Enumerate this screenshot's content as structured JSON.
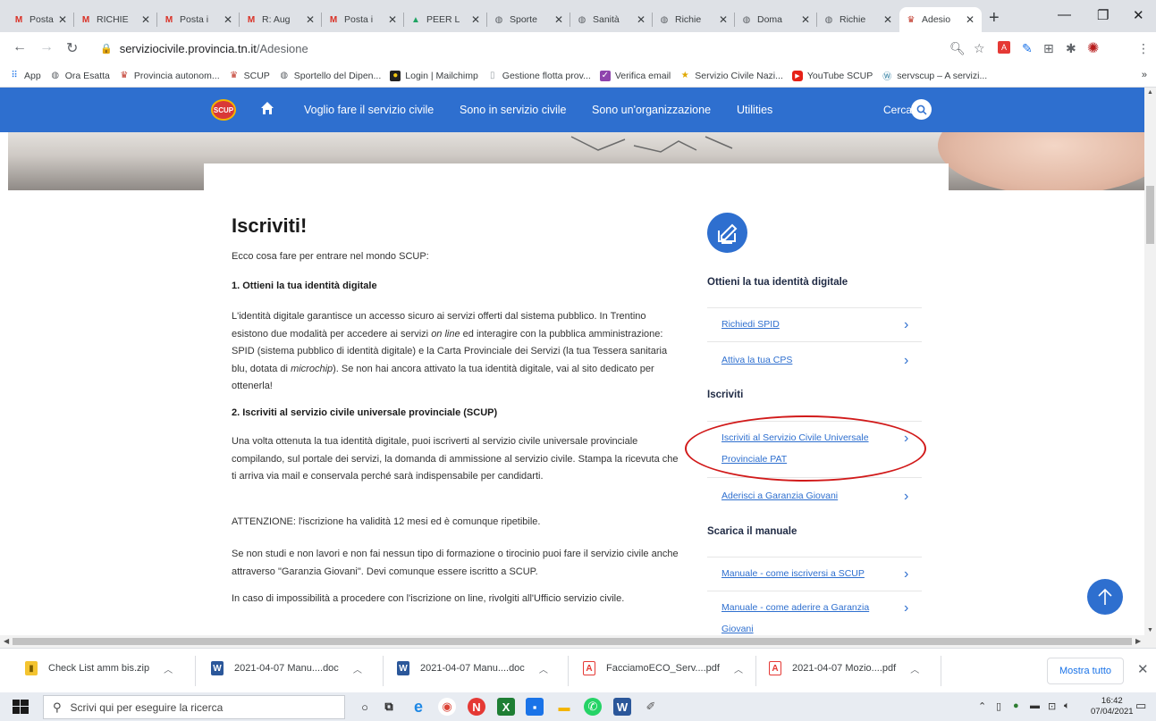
{
  "browser": {
    "tabs": [
      {
        "label": "Posta i",
        "icon": "gmail-icon"
      },
      {
        "label": "RICHIE",
        "icon": "gmail-icon"
      },
      {
        "label": "Posta i",
        "icon": "gmail-icon"
      },
      {
        "label": "R: Aug",
        "icon": "gmail-icon"
      },
      {
        "label": "Posta i",
        "icon": "gmail-icon"
      },
      {
        "label": "PEER L",
        "icon": "drive-icon"
      },
      {
        "label": "Sporte",
        "icon": "globe-icon"
      },
      {
        "label": "Sanità",
        "icon": "globe-icon"
      },
      {
        "label": "Richie",
        "icon": "globe-icon"
      },
      {
        "label": "Doma",
        "icon": "globe-icon"
      },
      {
        "label": "Richie",
        "icon": "globe-icon"
      },
      {
        "label": "Adesio",
        "icon": "crest-icon",
        "active": true
      }
    ],
    "url_domain": "serviziocivile.provincia.tn.it",
    "url_path": "/Adesione",
    "bookmarks": [
      {
        "label": "App",
        "icon": "apps-grid-icon"
      },
      {
        "label": "Ora Esatta",
        "icon": "globe-icon"
      },
      {
        "label": "Provincia autonom...",
        "icon": "crest-icon"
      },
      {
        "label": "SCUP",
        "icon": "crest-icon"
      },
      {
        "label": "Sportello del Dipen...",
        "icon": "globe-icon"
      },
      {
        "label": "Login | Mailchimp",
        "icon": "mailchimp-icon"
      },
      {
        "label": "Gestione flotta prov...",
        "icon": "page-icon"
      },
      {
        "label": "Verifica email",
        "icon": "verify-icon"
      },
      {
        "label": "Servizio Civile Nazi...",
        "icon": "star-icon"
      },
      {
        "label": "YouTube SCUP",
        "icon": "youtube-icon"
      },
      {
        "label": "servscup – A servizi...",
        "icon": "wordpress-icon"
      }
    ],
    "bookmarks_more": "»"
  },
  "site": {
    "logo_text": "SCUP",
    "nav": [
      "Voglio fare il servizio civile",
      "Sono in servizio civile",
      "Sono un'organizzazione",
      "Utilities"
    ],
    "search_label": "Cerca"
  },
  "content": {
    "title": "Iscriviti!",
    "intro": "Ecco cosa fare per entrare nel mondo SCUP:",
    "step1_title": "1. Ottieni la tua identità digitale",
    "step1_text_a": "L'identità digitale garantisce un accesso sicuro ai servizi offerti dal sistema pubblico. In Trentino esistono due modalità per accedere ai servizi ",
    "step1_text_b": "on line",
    "step1_text_c": " ed interagire con la pubblica amministrazione: SPID (sistema pubblico di identità digitale) e la Carta Provinciale dei Servizi (la tua Tessera sanitaria blu, dotata di ",
    "step1_text_d": "microchip",
    "step1_text_e": "). Se non hai ancora attivato la tua identità digitale, vai al sito dedicato per ottenerla!",
    "step2_title": "2. Iscriviti al servizio civile universale provinciale (SCUP)",
    "step2_text": "Una volta ottenuta la tua identità digitale, puoi iscriverti al servizio civile universale provinciale compilando, sul portale dei servizi, la domanda di ammissione al servizio civile. Stampa la ricevuta che ti arriva via mail e conservala perché sarà indispensabile per candidarti.",
    "warning": "ATTENZIONE: l'iscrizione ha validità 12 mesi ed è comunque ripetibile.",
    "garanzia": "Se non studi e non lavori e non fai nessun tipo di formazione o tirocinio puoi fare il servizio civile anche attraverso \"Garanzia Giovani\". Devi comunque essere iscritto a SCUP.",
    "office": "In caso di impossibilità a procedere con l'iscrizione on line, rivolgiti all'Ufficio servizio civile."
  },
  "sidebar": {
    "section1_title": "Ottieni la tua identità digitale",
    "section1_links": [
      "Richiedi SPID",
      "Attiva la tua CPS"
    ],
    "section2_title": "Iscriviti",
    "section2_links": [
      "Iscriviti al Servizio Civile Universale Provinciale PAT",
      "Aderisci a Garanzia Giovani"
    ],
    "section3_title": "Scarica il manuale",
    "section3_links": [
      "Manuale - come iscriversi a SCUP",
      "Manuale - come aderire a Garanzia Giovani"
    ]
  },
  "downloads": {
    "items": [
      {
        "name": "Check List amm bis.zip",
        "icon": "zip-icon"
      },
      {
        "name": "2021-04-07 Manu....doc",
        "icon": "word-icon"
      },
      {
        "name": "2021-04-07 Manu....doc",
        "icon": "word-icon"
      },
      {
        "name": "FacciamoECO_Serv....pdf",
        "icon": "pdf-icon"
      },
      {
        "name": "2021-04-07 Mozio....pdf",
        "icon": "pdf-icon"
      }
    ],
    "show_all": "Mostra tutto"
  },
  "taskbar": {
    "search_placeholder": "Scrivi qui per eseguire la ricerca",
    "time": "16:42",
    "date": "07/04/2021"
  },
  "colors": {
    "brand_blue": "#2e6fcf",
    "annotation_red": "#d11a1a"
  }
}
